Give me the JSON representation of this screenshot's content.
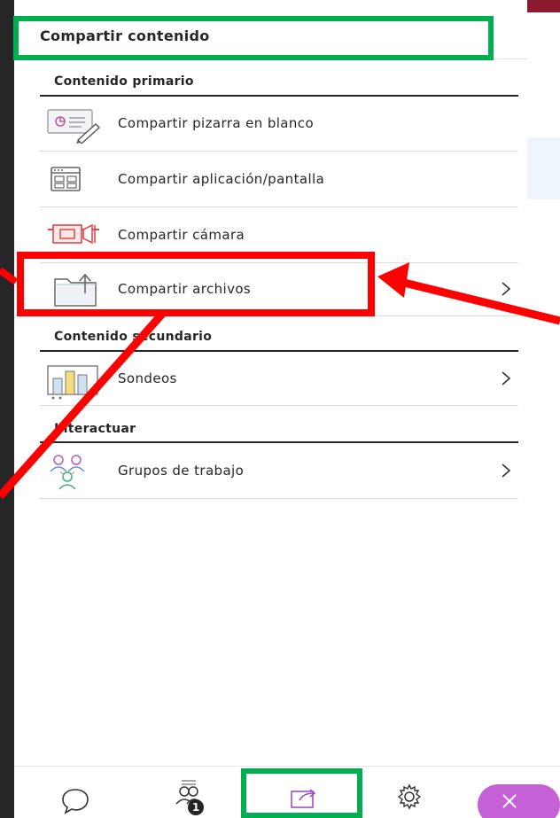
{
  "panel": {
    "title": "Compartir contenido",
    "sections": [
      {
        "label": "Contenido primario",
        "items": [
          {
            "label": "Compartir pizarra en blanco",
            "icon": "whiteboard-icon",
            "has_chevron": false
          },
          {
            "label": "Compartir aplicación/pantalla",
            "icon": "application-window-icon",
            "has_chevron": false
          },
          {
            "label": "Compartir cámara",
            "icon": "camera-icon",
            "has_chevron": false
          },
          {
            "label": "Compartir archivos",
            "icon": "file-upload-icon",
            "has_chevron": true
          }
        ]
      },
      {
        "label": "Contenido secundario",
        "items": [
          {
            "label": "Sondeos",
            "icon": "poll-chart-icon",
            "has_chevron": true
          }
        ]
      },
      {
        "label": "Interactuar",
        "items": [
          {
            "label": "Grupos de trabajo",
            "icon": "breakout-groups-icon",
            "has_chevron": true
          }
        ]
      }
    ]
  },
  "bottom_bar": {
    "buttons": [
      {
        "name": "chat-button",
        "icon": "chat-bubble-icon"
      },
      {
        "name": "attendees-button",
        "icon": "attendees-icon",
        "badge": "1"
      },
      {
        "name": "share-content-button",
        "icon": "share-icon"
      },
      {
        "name": "settings-button",
        "icon": "gear-icon"
      },
      {
        "name": "close-button",
        "icon": "close-icon"
      }
    ]
  },
  "colors": {
    "accent": "#9b4fc4",
    "close_pill": "#c660d6",
    "annotation_green": "#00b050",
    "annotation_red": "#ff0000",
    "camera_red": "#e0484b",
    "header_strip": "#8b1a2f"
  }
}
